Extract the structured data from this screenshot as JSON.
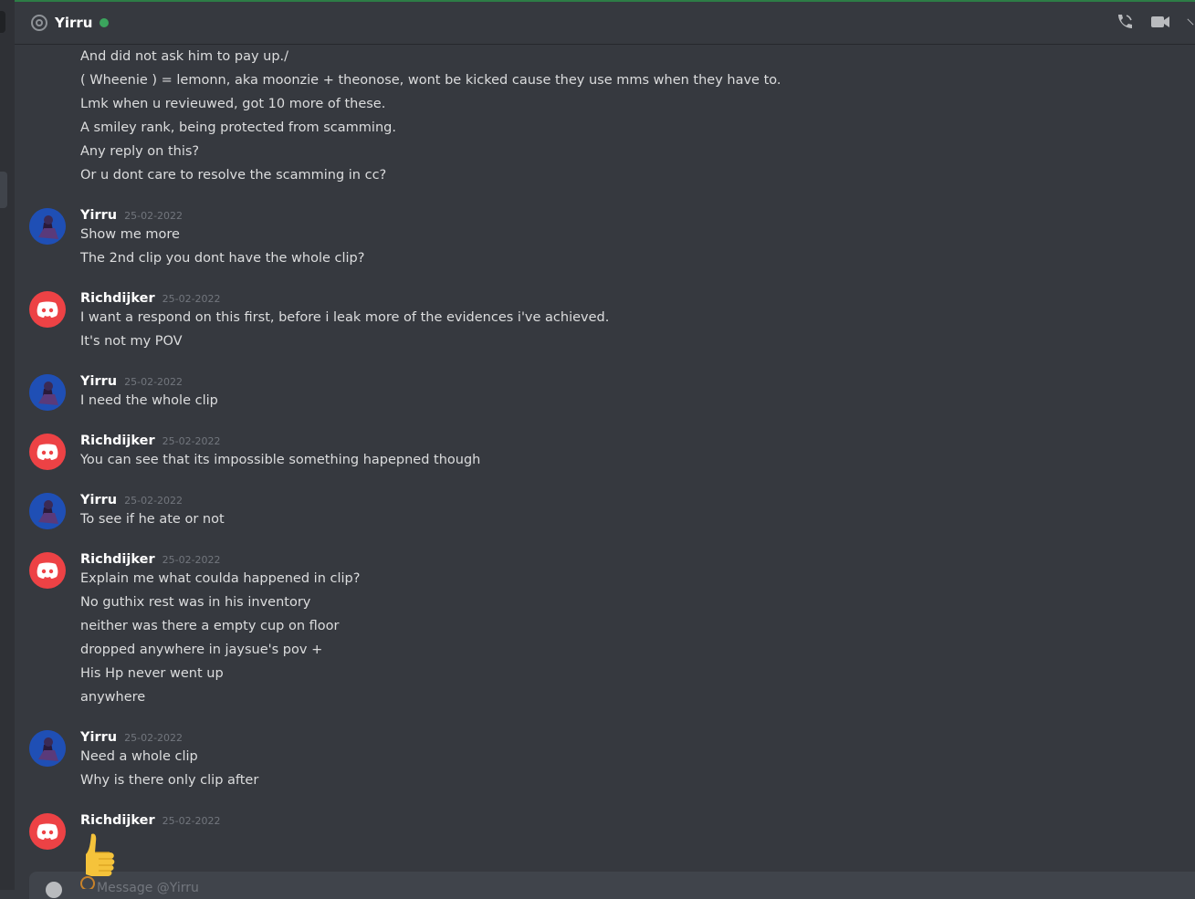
{
  "header": {
    "name": "Yirru",
    "status_color": "#3ba55d",
    "icons": [
      "at-icon",
      "phone-call-icon",
      "video-call-icon"
    ]
  },
  "continuation_lines": [
    "And did not ask him to pay up./",
    "( Wheenie ) = lemonn, aka moonzie + theonose, wont be kicked cause they use mms when they have to.",
    "Lmk when u revieuwed, got 10 more of these.",
    "A smiley rank, being protected from scamming.",
    "Any reply on this?",
    "Or u dont care to resolve the scamming in cc?"
  ],
  "messages": [
    {
      "author": "Yirru",
      "timestamp": "25-02-2022",
      "avatar": "yirru-avatar",
      "lines": [
        "Show me more",
        "The 2nd clip you dont have the whole clip?"
      ]
    },
    {
      "author": "Richdijker",
      "timestamp": "25-02-2022",
      "avatar": "discord-logo-icon",
      "lines": [
        "I want a respond on this first, before i leak more of the evidences i've achieved.",
        "It's not my POV"
      ]
    },
    {
      "author": "Yirru",
      "timestamp": "25-02-2022",
      "avatar": "yirru-avatar",
      "lines": [
        "I need the whole clip"
      ]
    },
    {
      "author": "Richdijker",
      "timestamp": "25-02-2022",
      "avatar": "discord-logo-icon",
      "lines": [
        "You can see that its impossible something hapepned though"
      ]
    },
    {
      "author": "Yirru",
      "timestamp": "25-02-2022",
      "avatar": "yirru-avatar",
      "lines": [
        "To see if he ate or not"
      ]
    },
    {
      "author": "Richdijker",
      "timestamp": "25-02-2022",
      "avatar": "discord-logo-icon",
      "lines": [
        "Explain me what coulda happened in clip?",
        "No guthix rest was in his inventory",
        "neither was there a empty cup on floor",
        "dropped anywhere in jaysue's pov +",
        "His Hp never went up",
        "anywhere"
      ]
    },
    {
      "author": "Yirru",
      "timestamp": "25-02-2022",
      "avatar": "yirru-avatar",
      "lines": [
        "Need a whole clip",
        "Why is there only clip after"
      ]
    },
    {
      "author": "Richdijker",
      "timestamp": "25-02-2022",
      "avatar": "discord-logo-icon",
      "lines": [],
      "emoji": "thumbs-up-emoji"
    }
  ],
  "composer": {
    "placeholder": "Message @Yirru"
  },
  "colors": {
    "background": "#36393f",
    "sidebar": "#2f3136",
    "discord_red": "#ed4245",
    "yirru_blue": "#1f4fb5"
  }
}
